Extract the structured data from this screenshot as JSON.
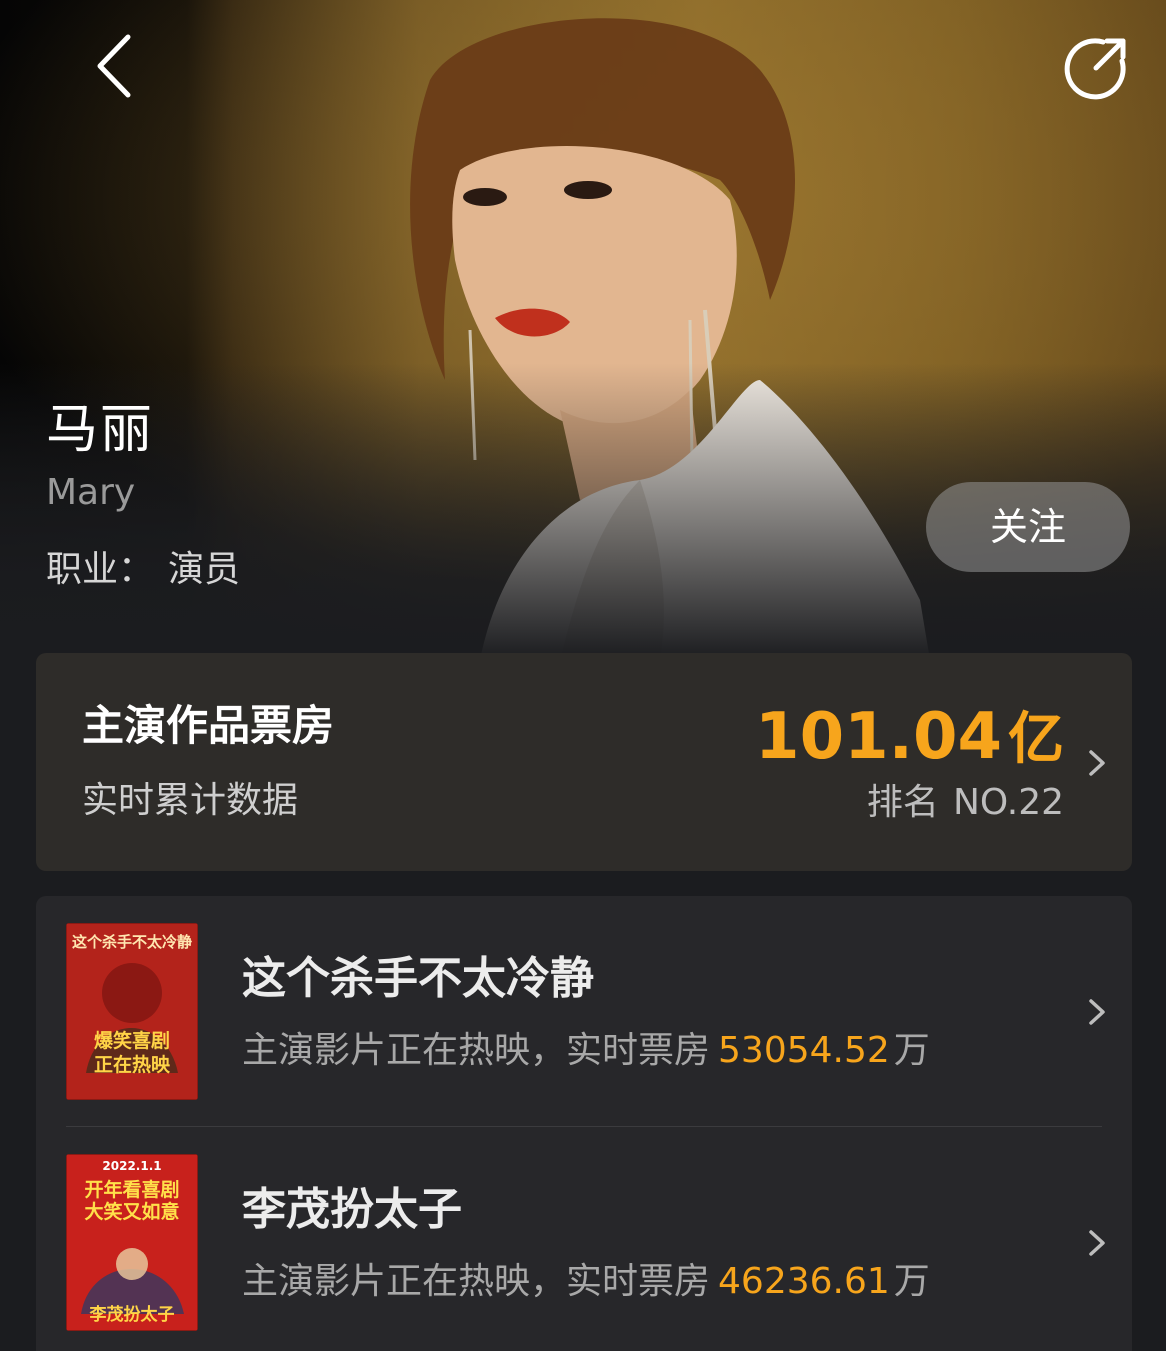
{
  "header": {
    "back_icon": "chevron-left-icon",
    "share_icon": "share-icon"
  },
  "actor": {
    "name": "马丽",
    "english_name": "Mary",
    "occupation_label": "职业：",
    "occupation_value": "演员",
    "follow_label": "关注"
  },
  "box_office": {
    "title": "主演作品票房",
    "subtitle": "实时累计数据",
    "total": "101.04",
    "total_unit": "亿",
    "rank_label": "排名",
    "rank_value": "NO.22",
    "chevron_icon": "chevron-right-icon"
  },
  "movies": [
    {
      "title": "这个杀手不太冷静",
      "status_text": "主演影片正在热映，实时票房",
      "gross": "53054.52",
      "gross_unit": "万",
      "poster": {
        "top_text": "这个杀手不太冷静",
        "tag_line1": "爆笑喜剧",
        "tag_line2": "正在热映",
        "color": "#b3231b"
      }
    },
    {
      "title": "李茂扮太子",
      "status_text": "主演影片正在热映，实时票房",
      "gross": "46236.61",
      "gross_unit": "万",
      "poster": {
        "date": "2022.1.1",
        "tag_line1": "开年看喜剧",
        "tag_line2": "大笑又如意",
        "bottom_text": "李茂扮太子",
        "color": "#c8211c"
      }
    }
  ],
  "colors": {
    "accent": "#f7a51c",
    "background": "#1b1c1f",
    "card": "#2e2c29"
  }
}
